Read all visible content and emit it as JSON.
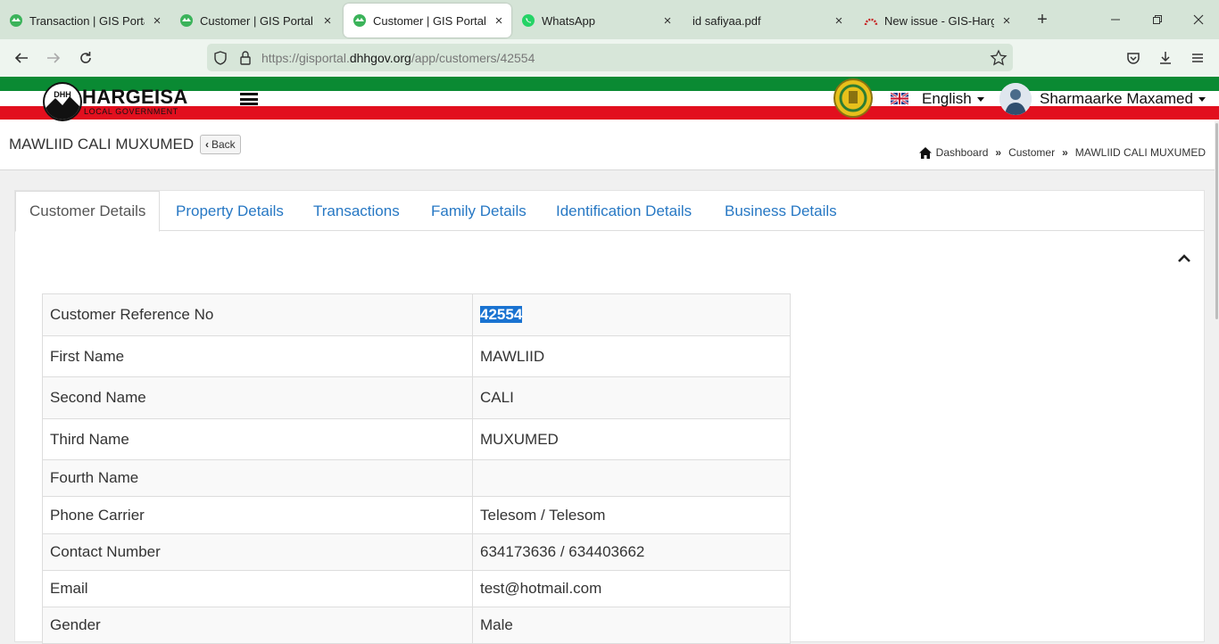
{
  "browser": {
    "tabs": [
      {
        "title": "Transaction | GIS Portal",
        "icon": "gis-favicon",
        "active": false
      },
      {
        "title": "Customer | GIS Portal",
        "icon": "gis-favicon",
        "active": false
      },
      {
        "title": "Customer | GIS Portal",
        "icon": "gis-favicon",
        "active": true
      },
      {
        "title": "WhatsApp",
        "icon": "whatsapp-icon",
        "active": false
      },
      {
        "title": "id safiyaa.pdf",
        "icon": "",
        "active": false
      },
      {
        "title": "New issue - GIS-Hargesia",
        "icon": "github-like-icon",
        "active": false
      }
    ],
    "close_glyph": "×",
    "new_tab_glyph": "+",
    "url_prefix": "https://gisportal.",
    "url_domain": "dhhgov.org",
    "url_path": "/app/customers/42554"
  },
  "header": {
    "logo_title": "HARGEISA",
    "logo_subtitle": "LOCAL GOVERNMENT",
    "logo_mark": "DHH",
    "language": "English",
    "user_name": "Sharmaarke Maxamed"
  },
  "page": {
    "title": "MAWLIID CALI MUXUMED",
    "back_label": "Back",
    "back_glyph": "‹",
    "breadcrumb": [
      "Dashboard",
      "Customer",
      "MAWLIID CALI MUXUMED"
    ],
    "breadcrumb_sep": "»"
  },
  "tabs": [
    "Customer Details",
    "Property Details",
    "Transactions",
    "Family Details",
    "Identification Details",
    "Business Details"
  ],
  "details": [
    {
      "label": "Customer Reference No",
      "value": "42554"
    },
    {
      "label": "First Name",
      "value": "MAWLIID"
    },
    {
      "label": "Second Name",
      "value": "CALI"
    },
    {
      "label": "Third Name",
      "value": "MUXUMED"
    },
    {
      "label": "Fourth Name",
      "value": ""
    },
    {
      "label": "Phone Carrier",
      "value": "Telesom / Telesom"
    },
    {
      "label": "Contact Number",
      "value": "634173636 / 634403662"
    },
    {
      "label": "Email",
      "value": "test@hotmail.com"
    },
    {
      "label": "Gender",
      "value": "Male"
    }
  ],
  "colors": {
    "flag_green": "#0a8a33",
    "flag_red": "#e20f1e",
    "link_blue": "#2778c4",
    "selection_blue": "#1a73d1"
  }
}
